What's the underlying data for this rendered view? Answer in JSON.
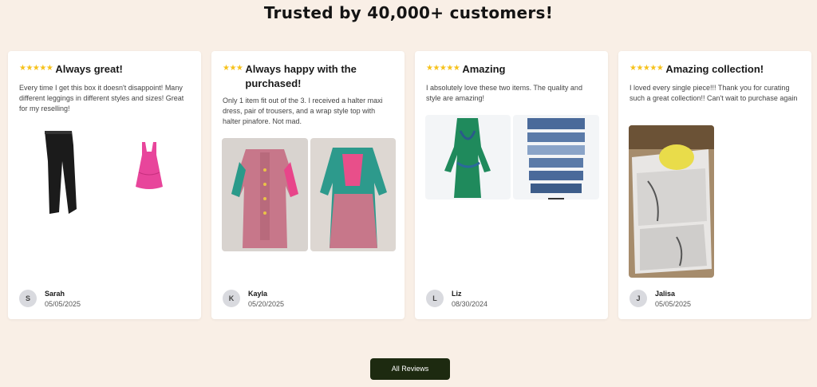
{
  "heading": "Trusted by 40,000+ customers!",
  "reviews": [
    {
      "stars": "★★★★★",
      "title": "Always great!",
      "text": "Every time I get this box it doesn't disappoint! Many different leggings in different styles and sizes! Great for my reselling!",
      "initial": "S",
      "name": "Sarah",
      "date": "05/05/2025"
    },
    {
      "stars": "★★★",
      "title": "Always happy with the purchased!",
      "text": "Only 1 item fit out of the 3. I received a halter maxi dress, pair of trousers, and a wrap style top with halter pinafore. Not mad.",
      "initial": "K",
      "name": "Kayla",
      "date": "05/20/2025"
    },
    {
      "stars": "★★★★★",
      "title": "Amazing",
      "text": "I absolutely love these two items. The quality and style are amazing!",
      "initial": "L",
      "name": "Liz",
      "date": "08/30/2024"
    },
    {
      "stars": "★★★★★",
      "title": "Amazing collection!",
      "text": "I loved every single piece!!! Thank you for curating such a great collection!! Can't wait to purchase again",
      "initial": "J",
      "name": "Jalisa",
      "date": "05/05/2025"
    }
  ],
  "button_label": "All Reviews",
  "colors": {
    "background": "#f9efe6",
    "star": "#f6c21c",
    "button": "#1d2a10"
  }
}
